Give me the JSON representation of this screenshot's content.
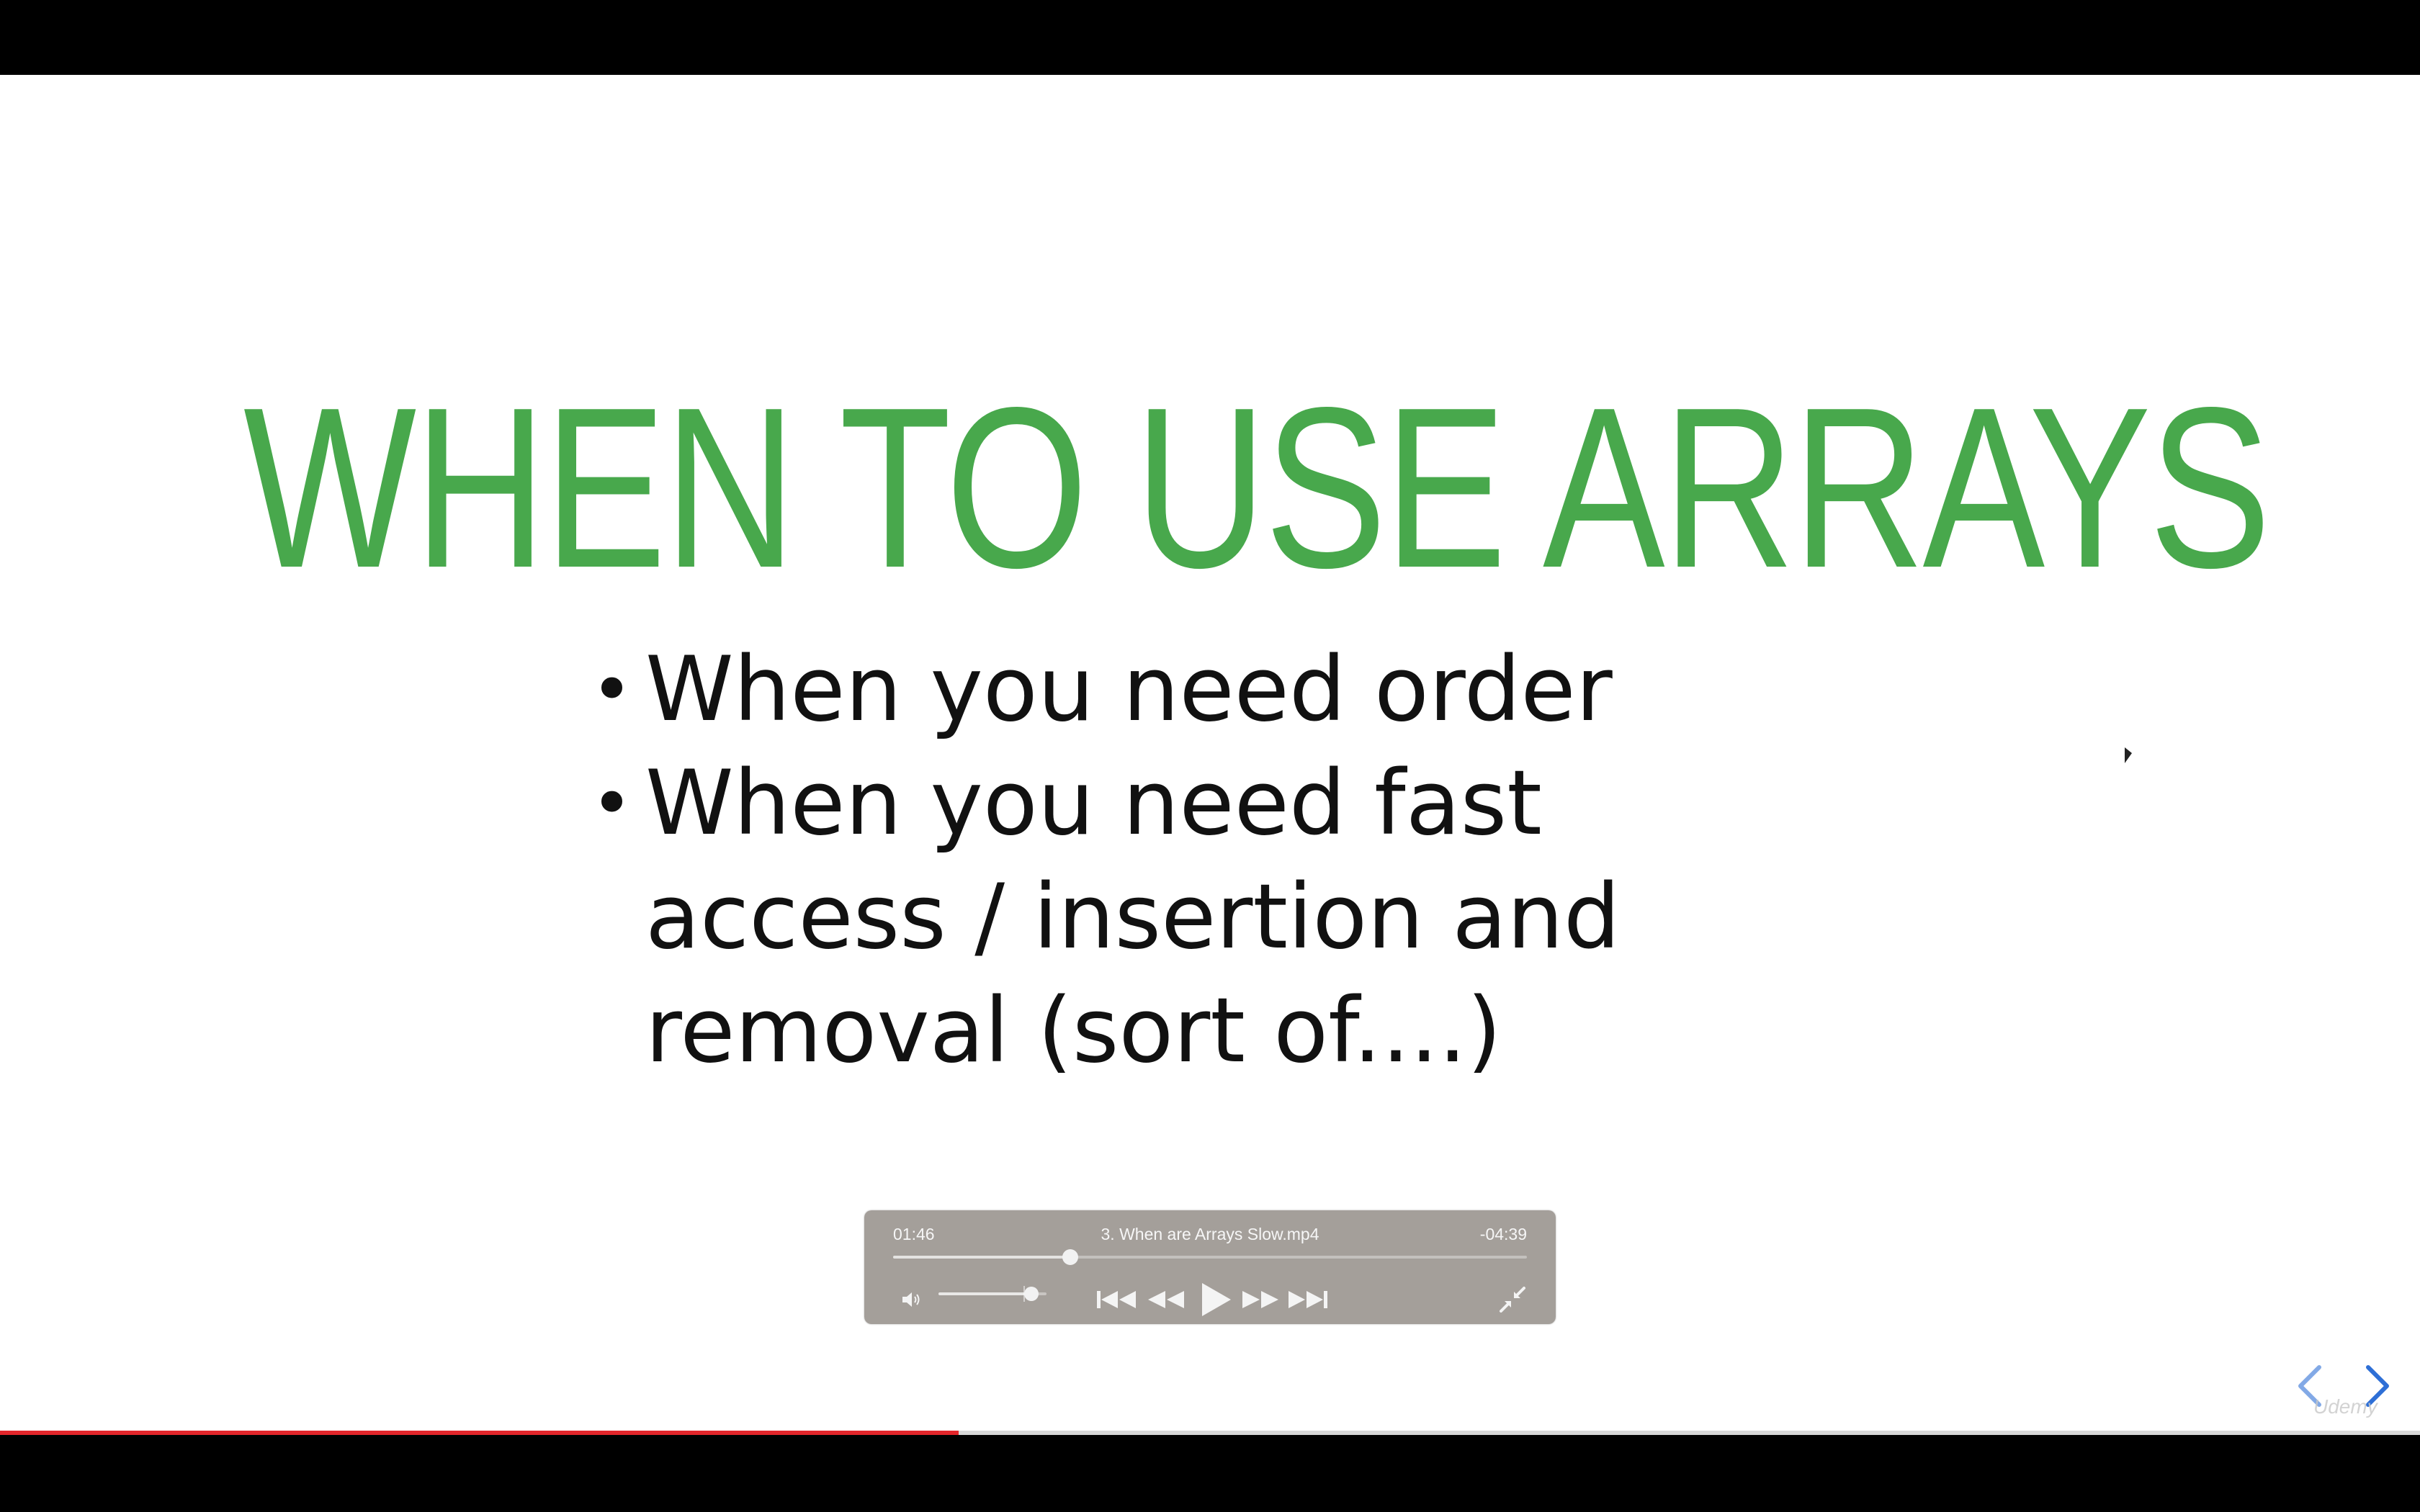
{
  "slide": {
    "title": "WHEN TO USE ARRAYS",
    "bullets": [
      "When you need order",
      "When you need fast access / insertion and removal (sort of....)"
    ],
    "bullet_lines": [
      [
        "When you need order"
      ],
      [
        "When you need fast",
        "access / insertion and",
        "removal (sort of....)"
      ]
    ],
    "bullet_glyph": "•"
  },
  "player": {
    "elapsed": "01:46",
    "filename": "3. When are Arrays Slow.mp4",
    "remaining": "-04:39",
    "playback_fraction": 0.28,
    "volume_fraction": 0.86,
    "controls": [
      "volume-icon",
      "skip-back-icon",
      "rewind-icon",
      "play-icon",
      "fast-forward-icon",
      "skip-forward-icon",
      "exit-fullscreen-icon"
    ]
  },
  "course_progress_fraction": 0.396,
  "nav": {
    "prev_icon": "chevron-left-icon",
    "next_icon": "chevron-right-icon"
  },
  "watermark": "Udemy",
  "colors": {
    "title_green": "#48a84c",
    "progress_red": "#e3262b",
    "nav_blue": "#2e6fd6",
    "hud_gray": "#a09b96"
  }
}
